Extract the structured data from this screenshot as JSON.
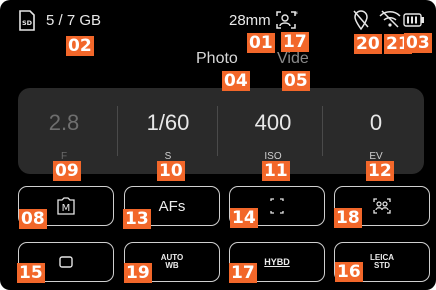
{
  "status": {
    "sd_label": "SD",
    "storage": "5 / 7 GB",
    "focal_length": "28mm"
  },
  "modes": {
    "photo": "Photo",
    "video": "Vide"
  },
  "params": [
    {
      "value": "2.8",
      "label": "F",
      "dim": true
    },
    {
      "value": "1/60",
      "label": "S",
      "dim": false
    },
    {
      "value": "400",
      "label": "ISO",
      "dim": false
    },
    {
      "value": "0",
      "label": "EV",
      "dim": false
    }
  ],
  "buttons": {
    "af_mode": "AFs",
    "wb_line1": "AUTO",
    "wb_line2": "WB",
    "hybd": "HYBD",
    "leica_line1": "LEICA",
    "leica_line2": "STD"
  },
  "markers": {
    "m01": "01",
    "m02": "02",
    "m03": "03",
    "m04": "04",
    "m05": "05",
    "m08": "08",
    "m09": "09",
    "m10": "10",
    "m11": "11",
    "m12": "12",
    "m13": "13",
    "m14": "14",
    "m15": "15",
    "m16": "16",
    "m17a": "17",
    "m17b": "17",
    "m18": "18",
    "m19": "19",
    "m20": "20",
    "m21": "21"
  },
  "colors": {
    "screen_bg": "#000000",
    "panel_bg": "#2a2a2a",
    "marker": "#f2672a"
  },
  "icons": [
    "sd-card-icon",
    "user-profile-icon",
    "location-off-icon",
    "bluetooth-off-icon",
    "battery-icon",
    "camera-mode-m-icon",
    "square-icon",
    "focus-frame-icon",
    "face-detection-icon"
  ]
}
